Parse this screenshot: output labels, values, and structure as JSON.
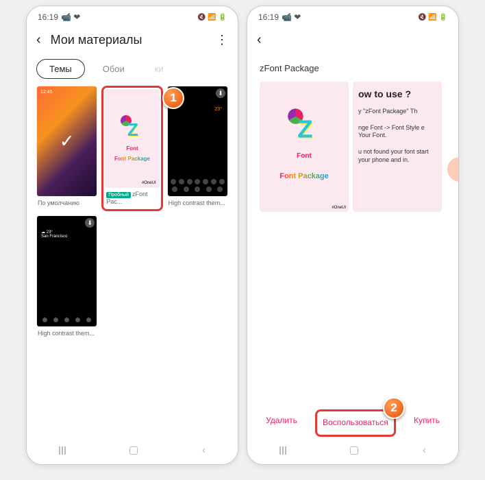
{
  "callouts": {
    "one": "1",
    "two": "2"
  },
  "left": {
    "status": {
      "time": "16:19",
      "icons": "📹 ❤",
      "right": "🔇 📶 🔋"
    },
    "header": {
      "title": "Мои материалы",
      "menu": "⋮"
    },
    "tabs": {
      "themes": "Темы",
      "wallpapers": "Обои",
      "icons": "ки"
    },
    "themes": {
      "default": {
        "label": "По умолчанию",
        "thumb_time": "12:45"
      },
      "zfont": {
        "label": "zFont Pac...",
        "badge": "Пробный",
        "t1": "Font",
        "t2": "Font Package",
        "brand": "#OneUI"
      },
      "hc1": {
        "label": "High contrast them..."
      },
      "hc2": {
        "label": "High contrast them..."
      }
    }
  },
  "right": {
    "status": {
      "time": "16:19",
      "icons": "📹 ❤",
      "right": "🔇 📶 🔋"
    },
    "title": "zFont Package",
    "card1": {
      "t1": "Font",
      "t2": "Font Package",
      "brand": "#OneUI"
    },
    "card2": {
      "title": "ow to use ?",
      "l1": "y \"zFont Package\" Th",
      "l2": "nge Font -> Font Style e Your Font.",
      "l3": "u not found your font start your phone and in."
    },
    "actions": {
      "delete": "Удалить",
      "use": "Воспользоваться",
      "buy": "Купить"
    }
  }
}
